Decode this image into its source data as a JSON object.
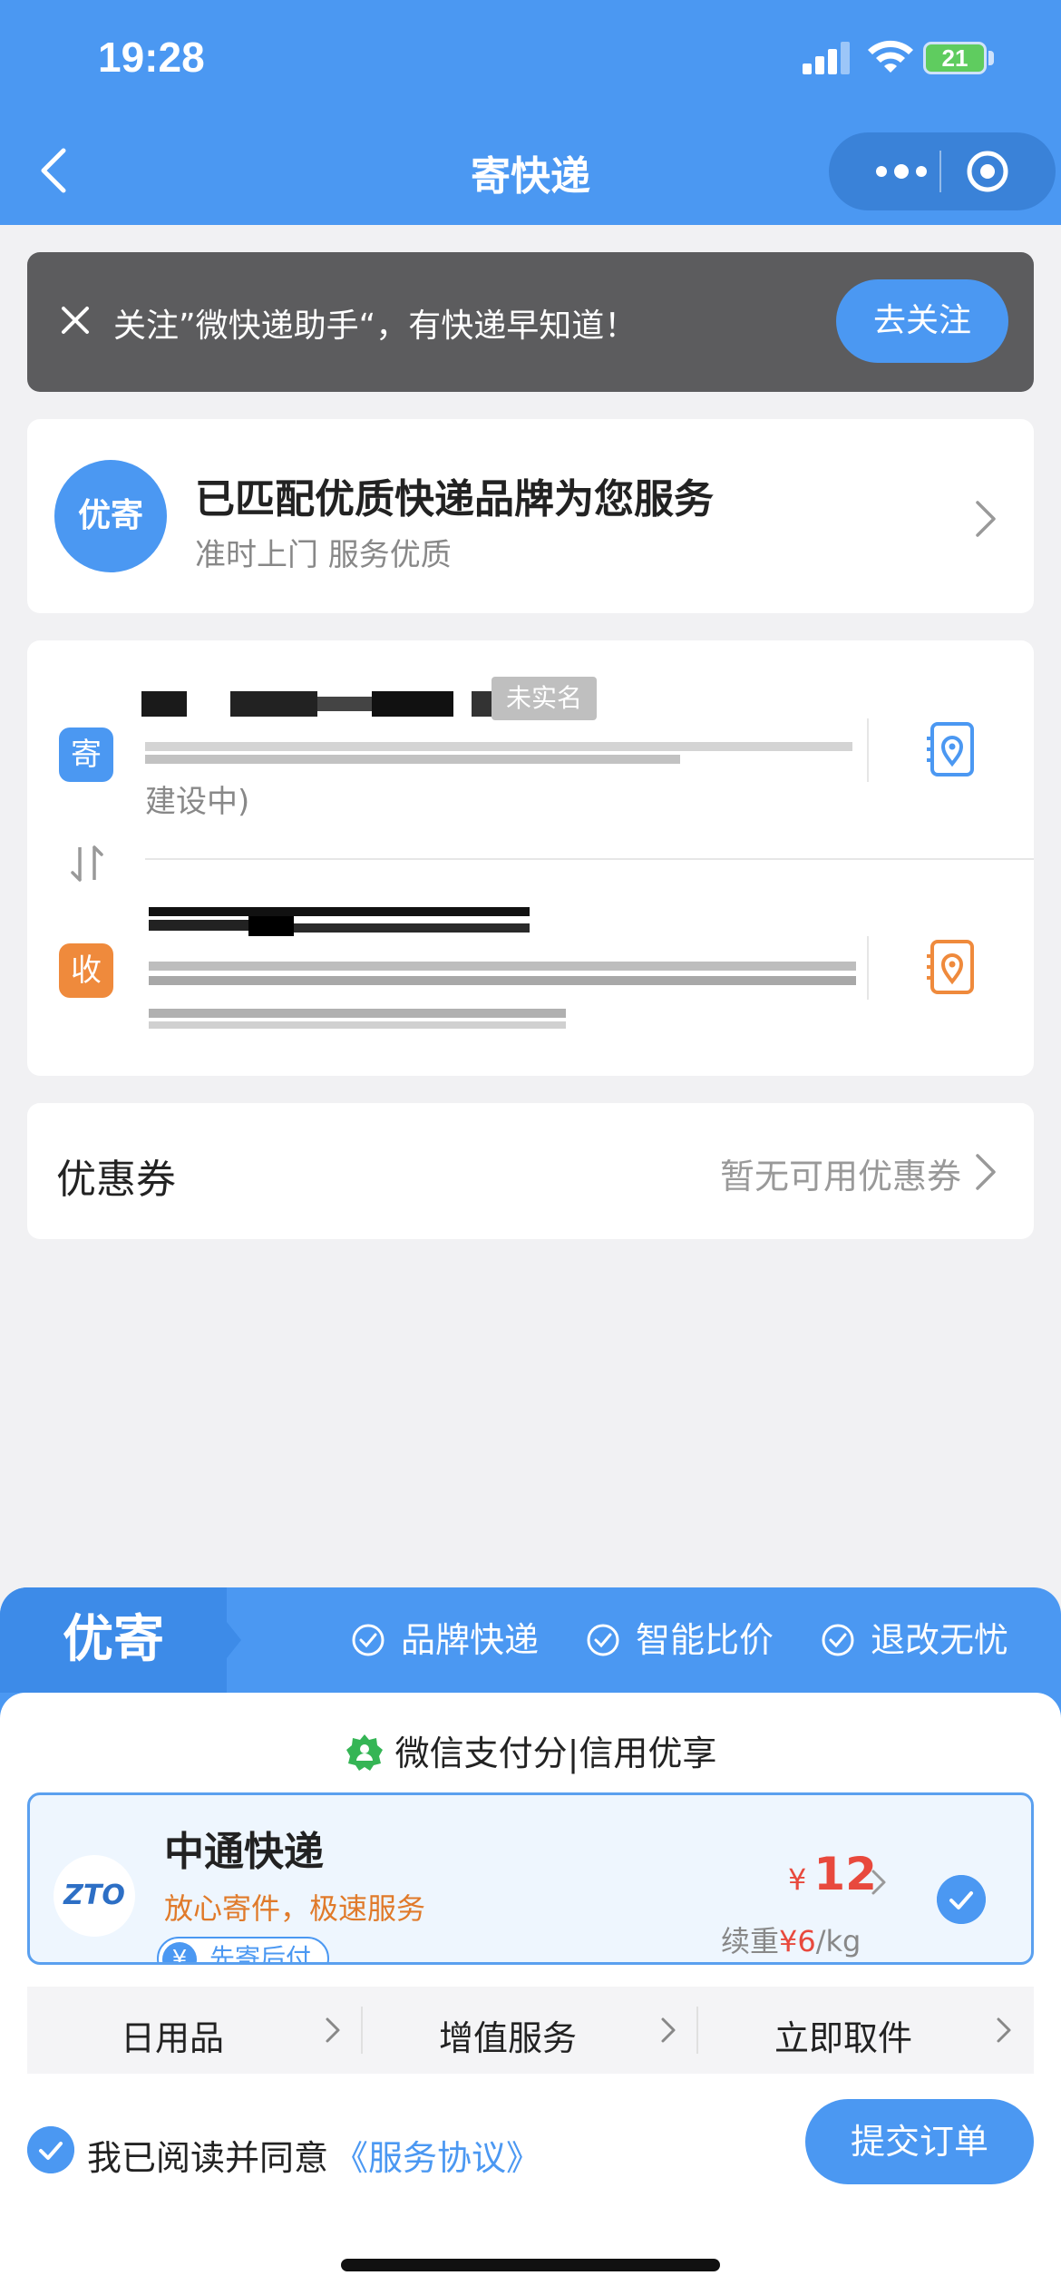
{
  "status": {
    "time": "19:28",
    "battery": "21"
  },
  "header": {
    "title": "寄快递"
  },
  "follow_banner": {
    "text": "关注”微快递助手“，有快递早知道！",
    "button": "去关注"
  },
  "brand_card": {
    "badge": "优寄",
    "title": "已匹配优质快递品牌为您服务",
    "subtitle": "准时上门 服务优质"
  },
  "sender": {
    "tag": "寄",
    "realname_badge": "未实名",
    "address_tail": "建设中)"
  },
  "receiver": {
    "tag": "收"
  },
  "coupon": {
    "label": "优惠券",
    "value": "暂无可用优惠券"
  },
  "panel": {
    "logo": "优寄",
    "features": [
      "品牌快递",
      "智能比价",
      "退改无忧"
    ],
    "pay_line": "微信支付分|信用优享"
  },
  "express": {
    "logo": "ZTO",
    "name": "中通快递",
    "slogan": "放心寄件，极速服务",
    "badge": "先寄后付",
    "badge_icon": "¥",
    "price_symbol": "¥",
    "price": "12",
    "renew_label": "续重",
    "renew_price": "¥6",
    "renew_unit": "/kg"
  },
  "tabs": [
    "日用品",
    "增值服务",
    "立即取件"
  ],
  "agreement": {
    "text": "我已阅读并同意",
    "link": "《服务协议》"
  },
  "submit": "提交订单",
  "colors": {
    "primary": "#4b98f2",
    "price": "#e8493d",
    "sender_tag": "#4b98f2",
    "receiver_tag": "#ef8a3c"
  },
  "icons": [
    "back-icon",
    "more-icon",
    "close-circle-icon",
    "close-icon",
    "chevron-right-icon",
    "address-book-icon",
    "swap-icon",
    "check-circle-icon",
    "wechat-pay-score-icon",
    "check-icon"
  ]
}
